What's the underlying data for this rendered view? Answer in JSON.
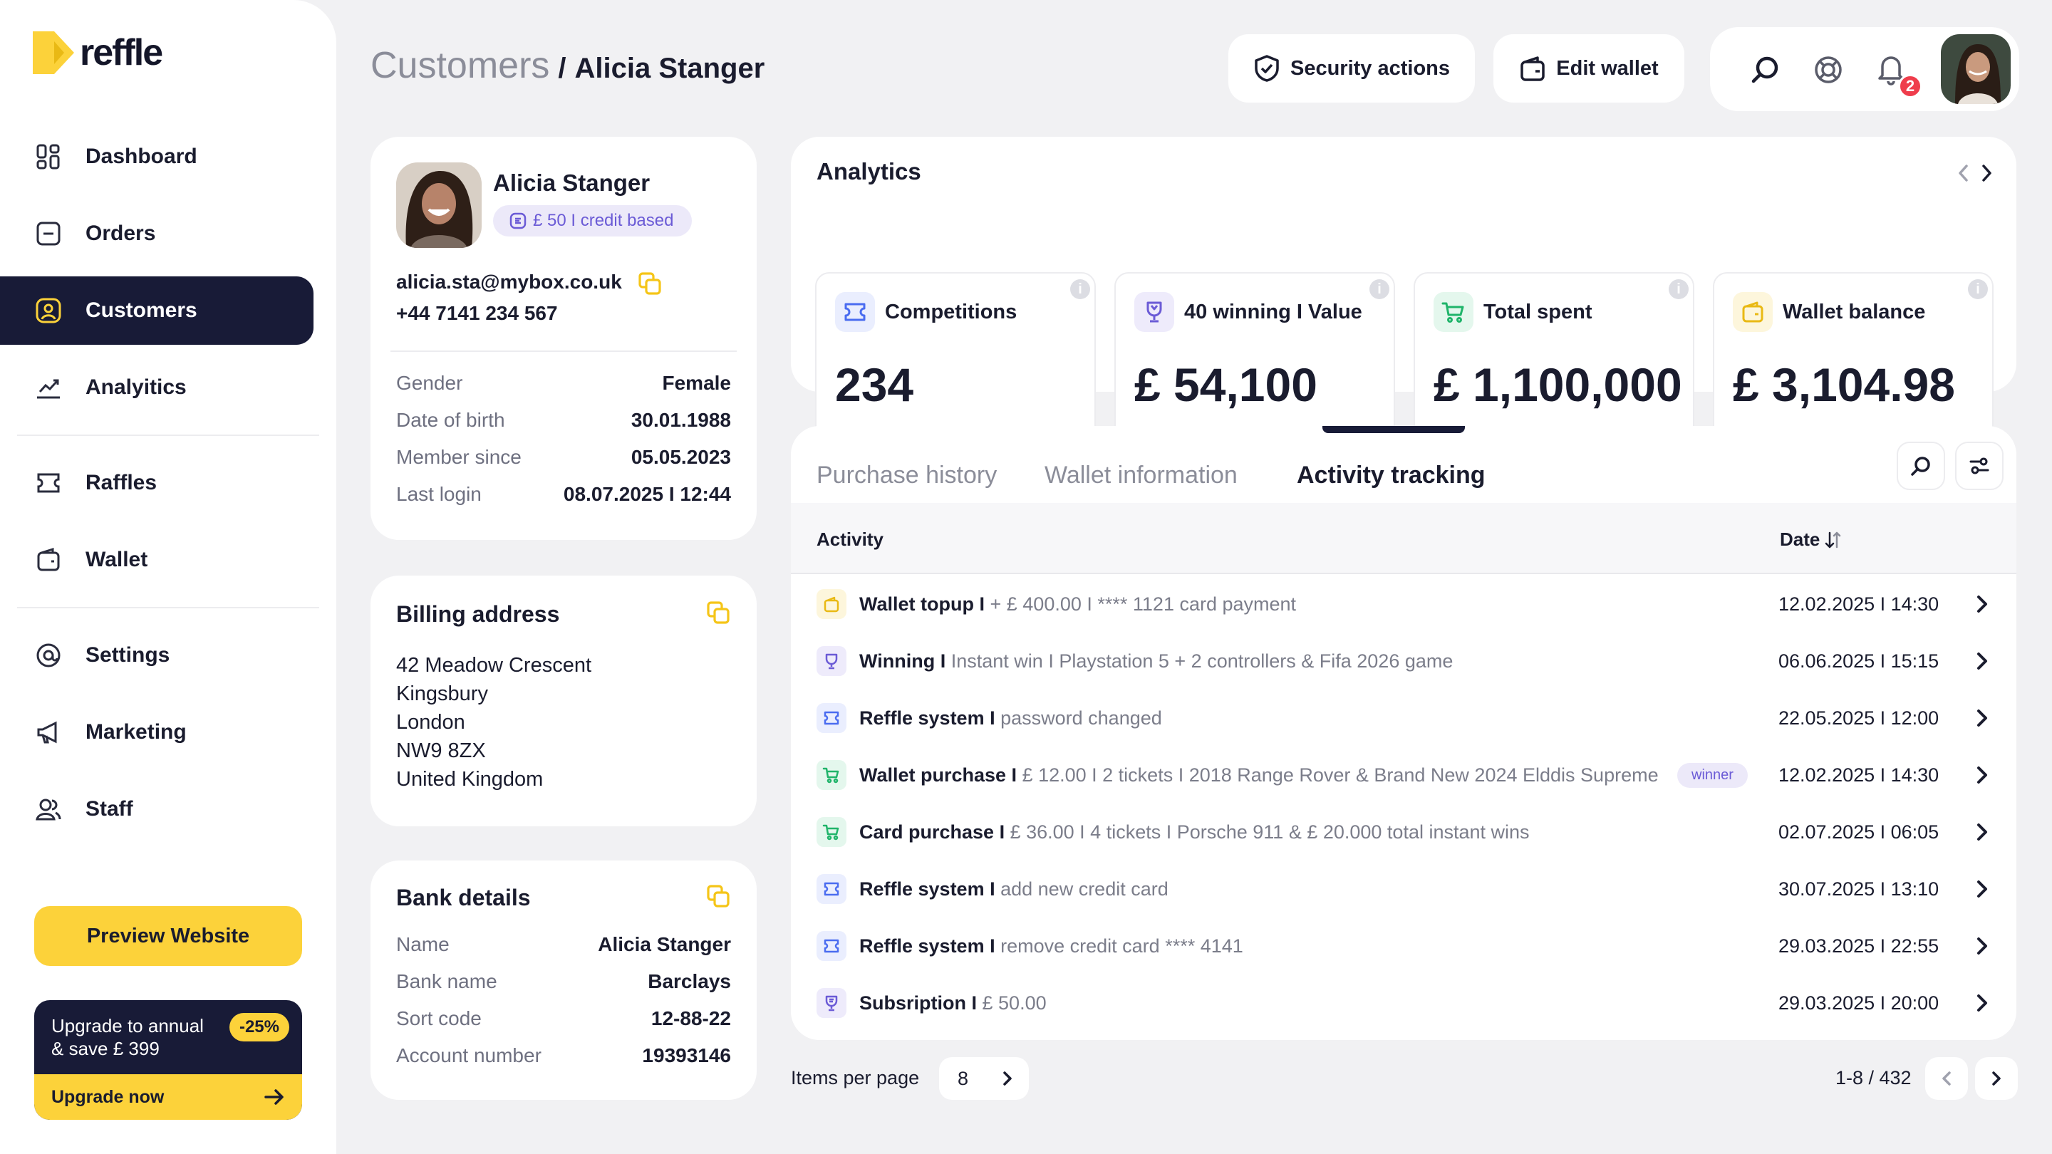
{
  "brand": {
    "name": "reffle",
    "accent": "#fcd23a",
    "dark": "#181b37"
  },
  "sidebar": {
    "items": [
      {
        "label": "Dashboard",
        "icon": "dashboard-icon"
      },
      {
        "label": "Orders",
        "icon": "orders-icon"
      },
      {
        "label": "Customers",
        "icon": "customers-icon",
        "active": true
      },
      {
        "label": "Analyitics",
        "icon": "analytics-icon"
      },
      {
        "label": "Raffles",
        "icon": "raffles-icon"
      },
      {
        "label": "Wallet",
        "icon": "wallet-icon"
      },
      {
        "label": "Settings",
        "icon": "settings-icon"
      },
      {
        "label": "Marketing",
        "icon": "marketing-icon"
      },
      {
        "label": "Staff",
        "icon": "staff-icon"
      }
    ],
    "preview_label": "Preview Website",
    "upgrade": {
      "line1": "Upgrade to annual",
      "line2": "& save £ 399",
      "badge": "-25%",
      "cta": "Upgrade now"
    }
  },
  "header": {
    "breadcrumb_root": "Customers",
    "breadcrumb_sep": "/",
    "breadcrumb_current": "Alicia Stanger",
    "security_label": "Security actions",
    "edit_wallet_label": "Edit wallet",
    "notification_count": "2"
  },
  "profile": {
    "name": "Alicia Stanger",
    "credit_badge": "£ 50 I credit based",
    "email": "alicia.sta@mybox.co.uk",
    "phone": "+44 7141 234 567",
    "fields": [
      {
        "key": "Gender",
        "value": "Female"
      },
      {
        "key": "Date of birth",
        "value": "30.01.1988"
      },
      {
        "key": "Member since",
        "value": "05.05.2023"
      },
      {
        "key": "Last login",
        "value": "08.07.2025 I 12:44"
      }
    ]
  },
  "billing": {
    "title": "Billing address",
    "lines": [
      "42 Meadow Crescent",
      "Kingsbury",
      "London",
      "NW9 8ZX",
      "United Kingdom"
    ]
  },
  "bank": {
    "title": "Bank details",
    "fields": [
      {
        "key": "Name",
        "value": "Alicia Stanger"
      },
      {
        "key": "Bank name",
        "value": "Barclays"
      },
      {
        "key": "Sort code",
        "value": "12-88-22"
      },
      {
        "key": "Account number",
        "value": "19393146"
      }
    ]
  },
  "analytics": {
    "title": "Analytics",
    "stats": [
      {
        "label": "Competitions",
        "value": "234",
        "icon": "ticket-icon",
        "color": "#4a6cf0",
        "bg": "#eaeefe"
      },
      {
        "label": "40 winning I Value",
        "value": "£ 54,100",
        "icon": "trophy-icon",
        "color": "#6b5bd6",
        "bg": "#eeebfb"
      },
      {
        "label": "Total spent",
        "value": "£ 1,100,000",
        "icon": "cart-icon",
        "color": "#20b46a",
        "bg": "#e4f7ed"
      },
      {
        "label": "Wallet balance",
        "value": "£ 3,104.98",
        "icon": "wallet-icon",
        "color": "#e9b914",
        "bg": "#fdf6dc"
      }
    ]
  },
  "activity": {
    "tabs": [
      "Purchase history",
      "Wallet information",
      "Activity tracking"
    ],
    "active_tab": 2,
    "col_activity": "Activity",
    "col_date": "Date",
    "rows": [
      {
        "title": "Wallet topup I",
        "desc": "+ £ 400.00 I **** 1121 card payment",
        "date": "12.02.2025 I 14:30",
        "icon": "wallet-icon",
        "color": "#e9b914",
        "bg": "#fdf6dc"
      },
      {
        "title": "Winning I",
        "desc": "Instant win I Playstation 5 + 2 controllers & Fifa 2026 game",
        "date": "06.06.2025 I 15:15",
        "icon": "trophy-icon",
        "color": "#6b5bd6",
        "bg": "#eeebfb"
      },
      {
        "title": "Reffle system I",
        "desc": "password changed",
        "date": "22.05.2025 I 12:00",
        "icon": "ticket-icon",
        "color": "#4a6cf0",
        "bg": "#eaeefe"
      },
      {
        "title": "Wallet purchase I",
        "desc": "£ 12.00 I 2 tickets I 2018 Range Rover & Brand New 2024 Elddis Supreme",
        "date": "12.02.2025 I 14:30",
        "icon": "cart-icon",
        "color": "#20b46a",
        "bg": "#e4f7ed",
        "badge": "winner"
      },
      {
        "title": "Card purchase I",
        "desc": "£ 36.00 I 4 tickets I Porsche 911 & £ 20.000 total instant wins",
        "date": "02.07.2025 I 06:05",
        "icon": "cart-icon",
        "color": "#20b46a",
        "bg": "#e4f7ed"
      },
      {
        "title": "Reffle system I",
        "desc": "add new credit card",
        "date": "30.07.2025 I 13:10",
        "icon": "ticket-icon",
        "color": "#4a6cf0",
        "bg": "#eaeefe"
      },
      {
        "title": "Reffle system I",
        "desc": "remove credit card **** 4141",
        "date": "29.03.2025 I 22:55",
        "icon": "ticket-icon",
        "color": "#4a6cf0",
        "bg": "#eaeefe"
      },
      {
        "title": "Subsription I",
        "desc": "£ 50.00",
        "date": "29.03.2025 I 20:00",
        "icon": "subscription-icon",
        "color": "#6b5bd6",
        "bg": "#eeebfb"
      }
    ]
  },
  "pagination": {
    "items_per_page_label": "Items per page",
    "items_per_page": "8",
    "range": "1-8 / 432"
  }
}
